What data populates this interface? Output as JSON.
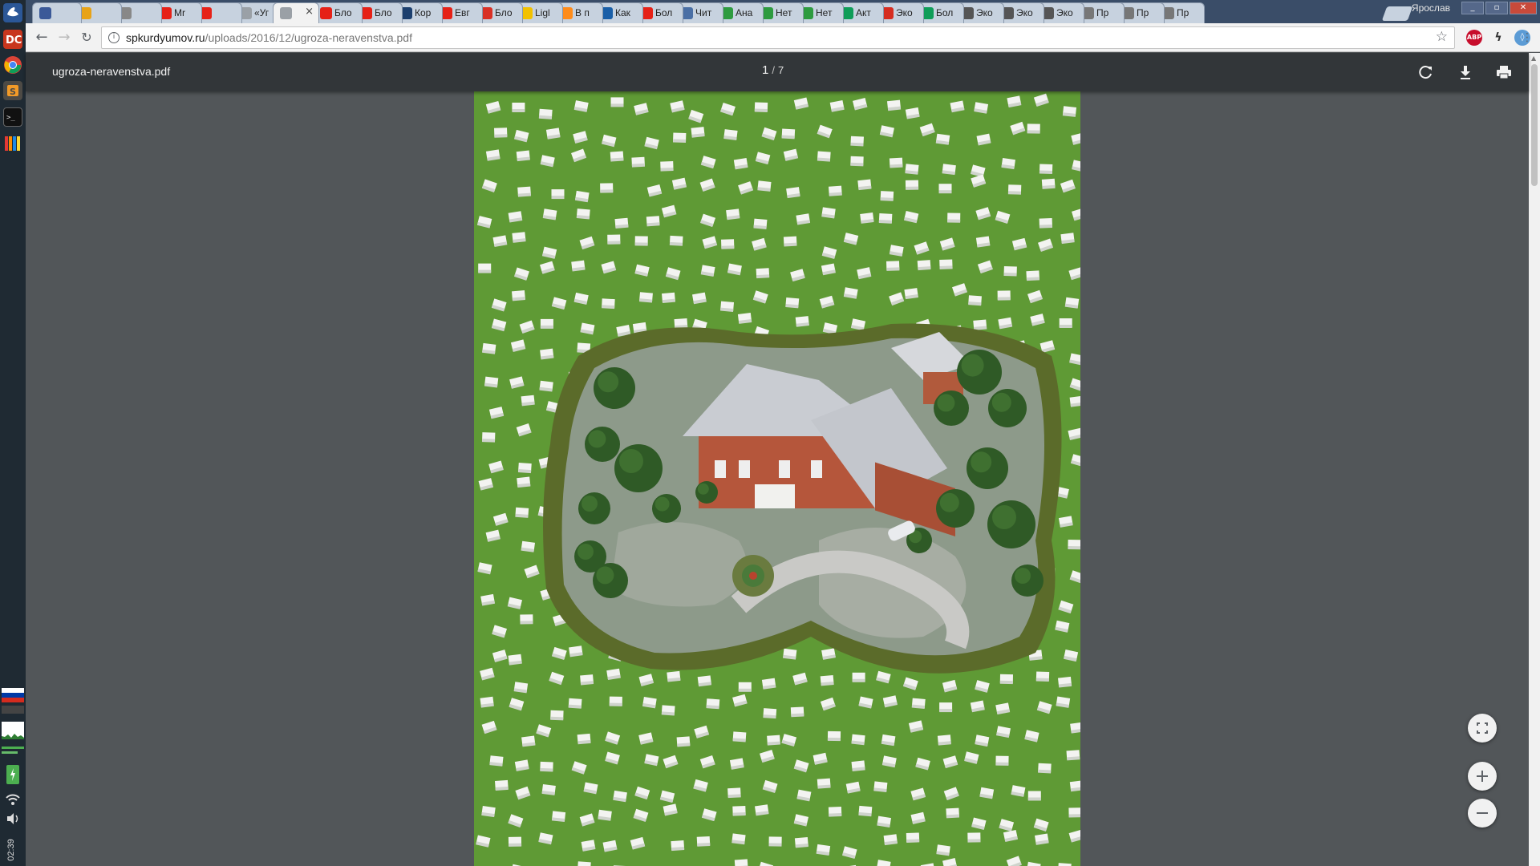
{
  "tabs": [
    {
      "label": "",
      "icon": "facebook-icon",
      "color": "#3b5998"
    },
    {
      "label": "",
      "icon": "gmail-icon",
      "color": "#e8a317"
    },
    {
      "label": "",
      "icon": "page-icon",
      "color": "#888888"
    },
    {
      "label": "Mr",
      "icon": "youtube-icon",
      "color": "#e62117"
    },
    {
      "label": "",
      "icon": "youtube-audio-icon",
      "color": "#e62117"
    },
    {
      "label": "«Уг",
      "icon": "document-icon",
      "color": "#9aa0a6"
    },
    {
      "label": "",
      "icon": "document-icon",
      "color": "#9aa0a6",
      "active": true
    },
    {
      "label": "Бло",
      "icon": "youtube-icon",
      "color": "#e62117"
    },
    {
      "label": "Бло",
      "icon": "youtube-icon",
      "color": "#e62117"
    },
    {
      "label": "Кор",
      "icon": "c-icon",
      "color": "#1c3f6e"
    },
    {
      "label": "Евг",
      "icon": "youtube-icon",
      "color": "#e62117"
    },
    {
      "label": "Бло",
      "icon": "pdf-icon",
      "color": "#d93025"
    },
    {
      "label": "Ligl",
      "icon": "b-icon",
      "color": "#f2c100"
    },
    {
      "label": "В п",
      "icon": "orange-circle-icon",
      "color": "#ff8c1a"
    },
    {
      "label": "Как",
      "icon": "square-icon",
      "color": "#1a5fa8"
    },
    {
      "label": "Бол",
      "icon": "youtube-icon",
      "color": "#e62117"
    },
    {
      "label": "Чит",
      "icon": "shield-icon",
      "color": "#4a6fa5"
    },
    {
      "label": "Ана",
      "icon": "green-flower-icon",
      "color": "#2e9b3f"
    },
    {
      "label": "Нет",
      "icon": "green-flower-icon",
      "color": "#2e9b3f"
    },
    {
      "label": "Нет",
      "icon": "green-flower-icon",
      "color": "#2e9b3f"
    },
    {
      "label": "Акт",
      "icon": "sheets-icon",
      "color": "#0f9d58"
    },
    {
      "label": "Эко",
      "icon": "red-flower-icon",
      "color": "#d62d20"
    },
    {
      "label": "Бол",
      "icon": "m-icon",
      "color": "#0f9d58"
    },
    {
      "label": "Эко",
      "icon": "edit-icon",
      "color": "#555555"
    },
    {
      "label": "Эко",
      "icon": "edit-icon",
      "color": "#555555"
    },
    {
      "label": "Эко",
      "icon": "edit-icon",
      "color": "#555555"
    },
    {
      "label": "Пр",
      "icon": "gear-page-icon",
      "color": "#777777"
    },
    {
      "label": "Пр",
      "icon": "gear-page-icon",
      "color": "#777777"
    },
    {
      "label": "Пр",
      "icon": "gear-page-icon",
      "color": "#777777"
    }
  ],
  "window": {
    "user": "Ярослав"
  },
  "address": {
    "host": "spkurdyumov.ru",
    "path": "/uploads/2016/12/ugroza-neravenstva.pdf"
  },
  "pdf": {
    "filename": "ugroza-neravenstva.pdf",
    "current_page": "1",
    "separator": "/",
    "total_pages": "7"
  },
  "dock": {
    "clock": "02:39"
  },
  "colors": {
    "tabstrip": "#3a4d68",
    "pdf_toolbar": "#323639",
    "viewer_bg": "#525659",
    "grass": "#5f9a35",
    "accent_flag_red": "#d52b1e",
    "accent_flag_blue": "#0039a6"
  }
}
